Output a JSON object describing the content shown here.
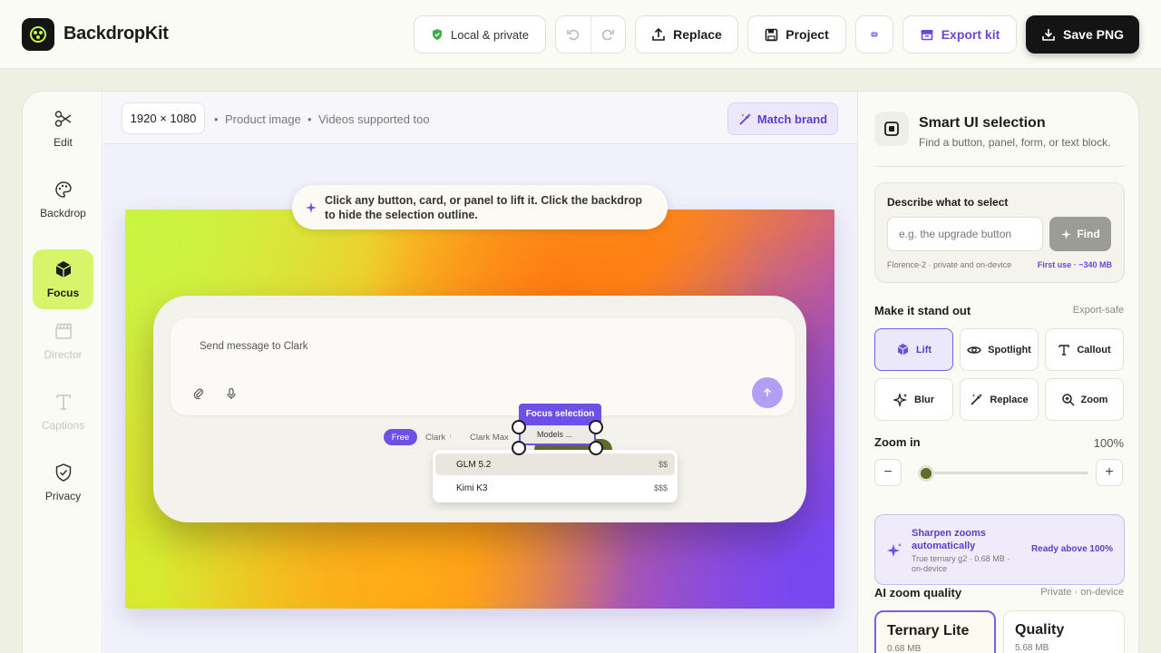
{
  "app": {
    "brand": "BackdropKit"
  },
  "topbar": {
    "private_label": "Local & private",
    "replace_label": "Replace",
    "project_label": "Project",
    "export_label": "Export kit",
    "save_label": "Save PNG"
  },
  "rail": {
    "items": [
      {
        "label": "Edit",
        "icon": "scissors-icon",
        "state": "normal"
      },
      {
        "label": "Backdrop",
        "icon": "palette-icon",
        "state": "normal"
      },
      {
        "label": "Focus",
        "icon": "cube-icon",
        "state": "active"
      },
      {
        "label": "Director",
        "icon": "clapper-icon",
        "state": "disabled"
      },
      {
        "label": "Captions",
        "icon": "text-icon",
        "state": "disabled"
      },
      {
        "label": "Privacy",
        "icon": "shield-check-icon",
        "state": "normal"
      }
    ]
  },
  "canvas": {
    "dimensions": "1920 × 1080",
    "meta1": "Product image",
    "meta2": "Videos supported too",
    "match_label": "Match brand",
    "hint": "Click any button, card, or panel to lift it. Click the backdrop to hide the selection outline.",
    "shot": {
      "placeholder": "Send message to Clark",
      "pill_free": "Free",
      "pill_clark": "Clark",
      "pill_clark_max": "Clark Max",
      "selection_label": "Focus selection",
      "selected_text": "Models ...",
      "dropdown": [
        {
          "name": "GLM 5.2",
          "price": "$$"
        },
        {
          "name": "Kimi K3",
          "price": "$$$"
        }
      ]
    }
  },
  "panel": {
    "title": "Smart UI selection",
    "subtitle": "Find a button, panel, form, or text block.",
    "describe_label": "Describe what to select",
    "describe_placeholder": "e.g. the upgrade button",
    "find_label": "Find",
    "describe_note": "Florence-2 · private and on-device",
    "first_use": "First use · ~340 MB",
    "standout_title": "Make it stand out",
    "standout_aside": "Export-safe",
    "effects": [
      {
        "label": "Lift",
        "icon": "cube-icon",
        "active": true
      },
      {
        "label": "Spotlight",
        "icon": "eye-icon",
        "active": false
      },
      {
        "label": "Callout",
        "icon": "text-icon",
        "active": false
      },
      {
        "label": "Blur",
        "icon": "sparkle-icon",
        "active": false
      },
      {
        "label": "Replace",
        "icon": "wand-icon",
        "active": false
      },
      {
        "label": "Zoom",
        "icon": "zoom-icon",
        "active": false
      }
    ],
    "zoom_label": "Zoom in",
    "zoom_value": "100%",
    "zoom_level": 0.05,
    "sharpen_title": "Sharpen zooms automatically",
    "sharpen_sub": "True ternary g2 · 0.68 MB · on-device",
    "sharpen_ready": "Ready above 100%",
    "quality_title": "AI zoom quality",
    "quality_aside": "Private · on-device",
    "quality_options": [
      {
        "name": "Ternary Lite",
        "size": "0.68 MB",
        "active": true
      },
      {
        "name": "Quality",
        "size": "5.68 MB",
        "active": false
      }
    ]
  },
  "colors": {
    "accent": "#6e50e6",
    "lime": "#d6f56b",
    "dark": "#141414"
  }
}
